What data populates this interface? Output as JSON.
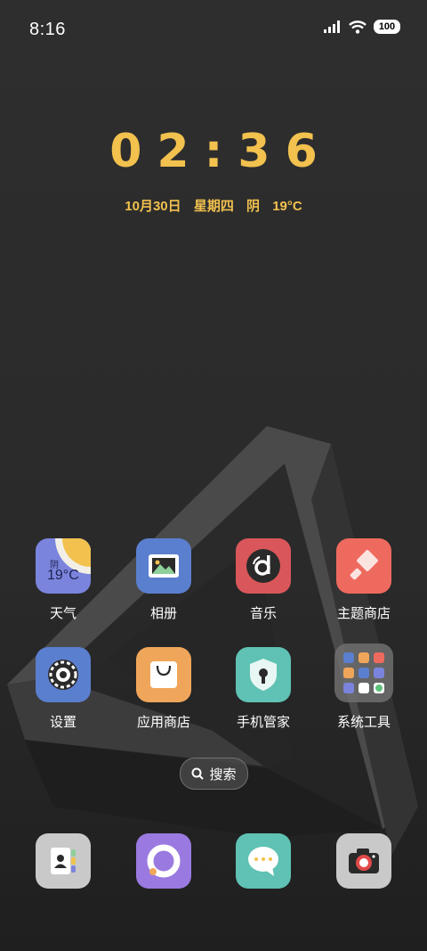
{
  "status_bar": {
    "time": "8:16",
    "battery": "100",
    "icons": [
      "signal-icon",
      "wifi-icon",
      "battery-icon"
    ]
  },
  "lock_clock": {
    "time": "02:36",
    "date": "10月30日",
    "weekday": "星期四",
    "weather": "阴",
    "temperature": "19°C"
  },
  "weather_widget": {
    "condition": "阴",
    "temperature": "19°C"
  },
  "apps_row1": [
    {
      "label": "天气",
      "icon": "weather-icon"
    },
    {
      "label": "相册",
      "icon": "gallery-icon"
    },
    {
      "label": "音乐",
      "icon": "music-icon"
    },
    {
      "label": "主题商店",
      "icon": "theme-store-icon"
    }
  ],
  "apps_row2": [
    {
      "label": "设置",
      "icon": "settings-icon"
    },
    {
      "label": "应用商店",
      "icon": "app-store-icon"
    },
    {
      "label": "手机管家",
      "icon": "phone-manager-icon"
    },
    {
      "label": "系统工具",
      "icon": "system-tools-folder-icon"
    }
  ],
  "search": {
    "label": "搜索",
    "icon": "search-icon"
  },
  "dock": [
    {
      "icon": "contacts-icon"
    },
    {
      "icon": "browser-icon"
    },
    {
      "icon": "messages-icon"
    },
    {
      "icon": "camera-icon"
    }
  ],
  "colors": {
    "accent": "#f2c14e",
    "background": "#2a2a2a"
  }
}
